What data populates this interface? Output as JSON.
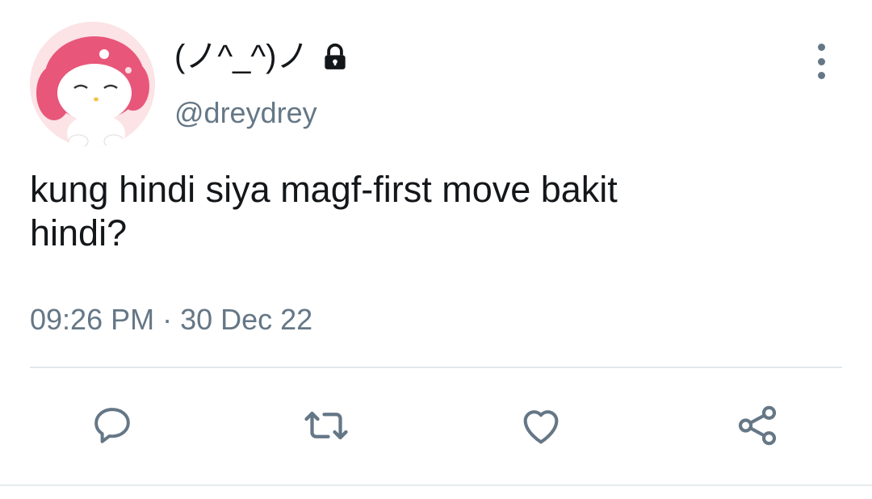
{
  "user": {
    "display_name": "(ノ^_^)ノ",
    "handle": "@dreydrey",
    "avatar_icon": "pink-bunny-character-avatar",
    "protected_icon": "lock-icon"
  },
  "tweet": {
    "text": "kung hindi siya magf-first move bakit\nhindi?",
    "time": "09:26 PM",
    "separator": "·",
    "date": "30 Dec 22"
  },
  "actions": [
    {
      "icon": "reply-icon"
    },
    {
      "icon": "retweet-icon"
    },
    {
      "icon": "like-icon"
    },
    {
      "icon": "share-icon"
    }
  ],
  "colors": {
    "text": "#14171a",
    "secondary": "#657786",
    "divider": "#e1e8ed"
  }
}
